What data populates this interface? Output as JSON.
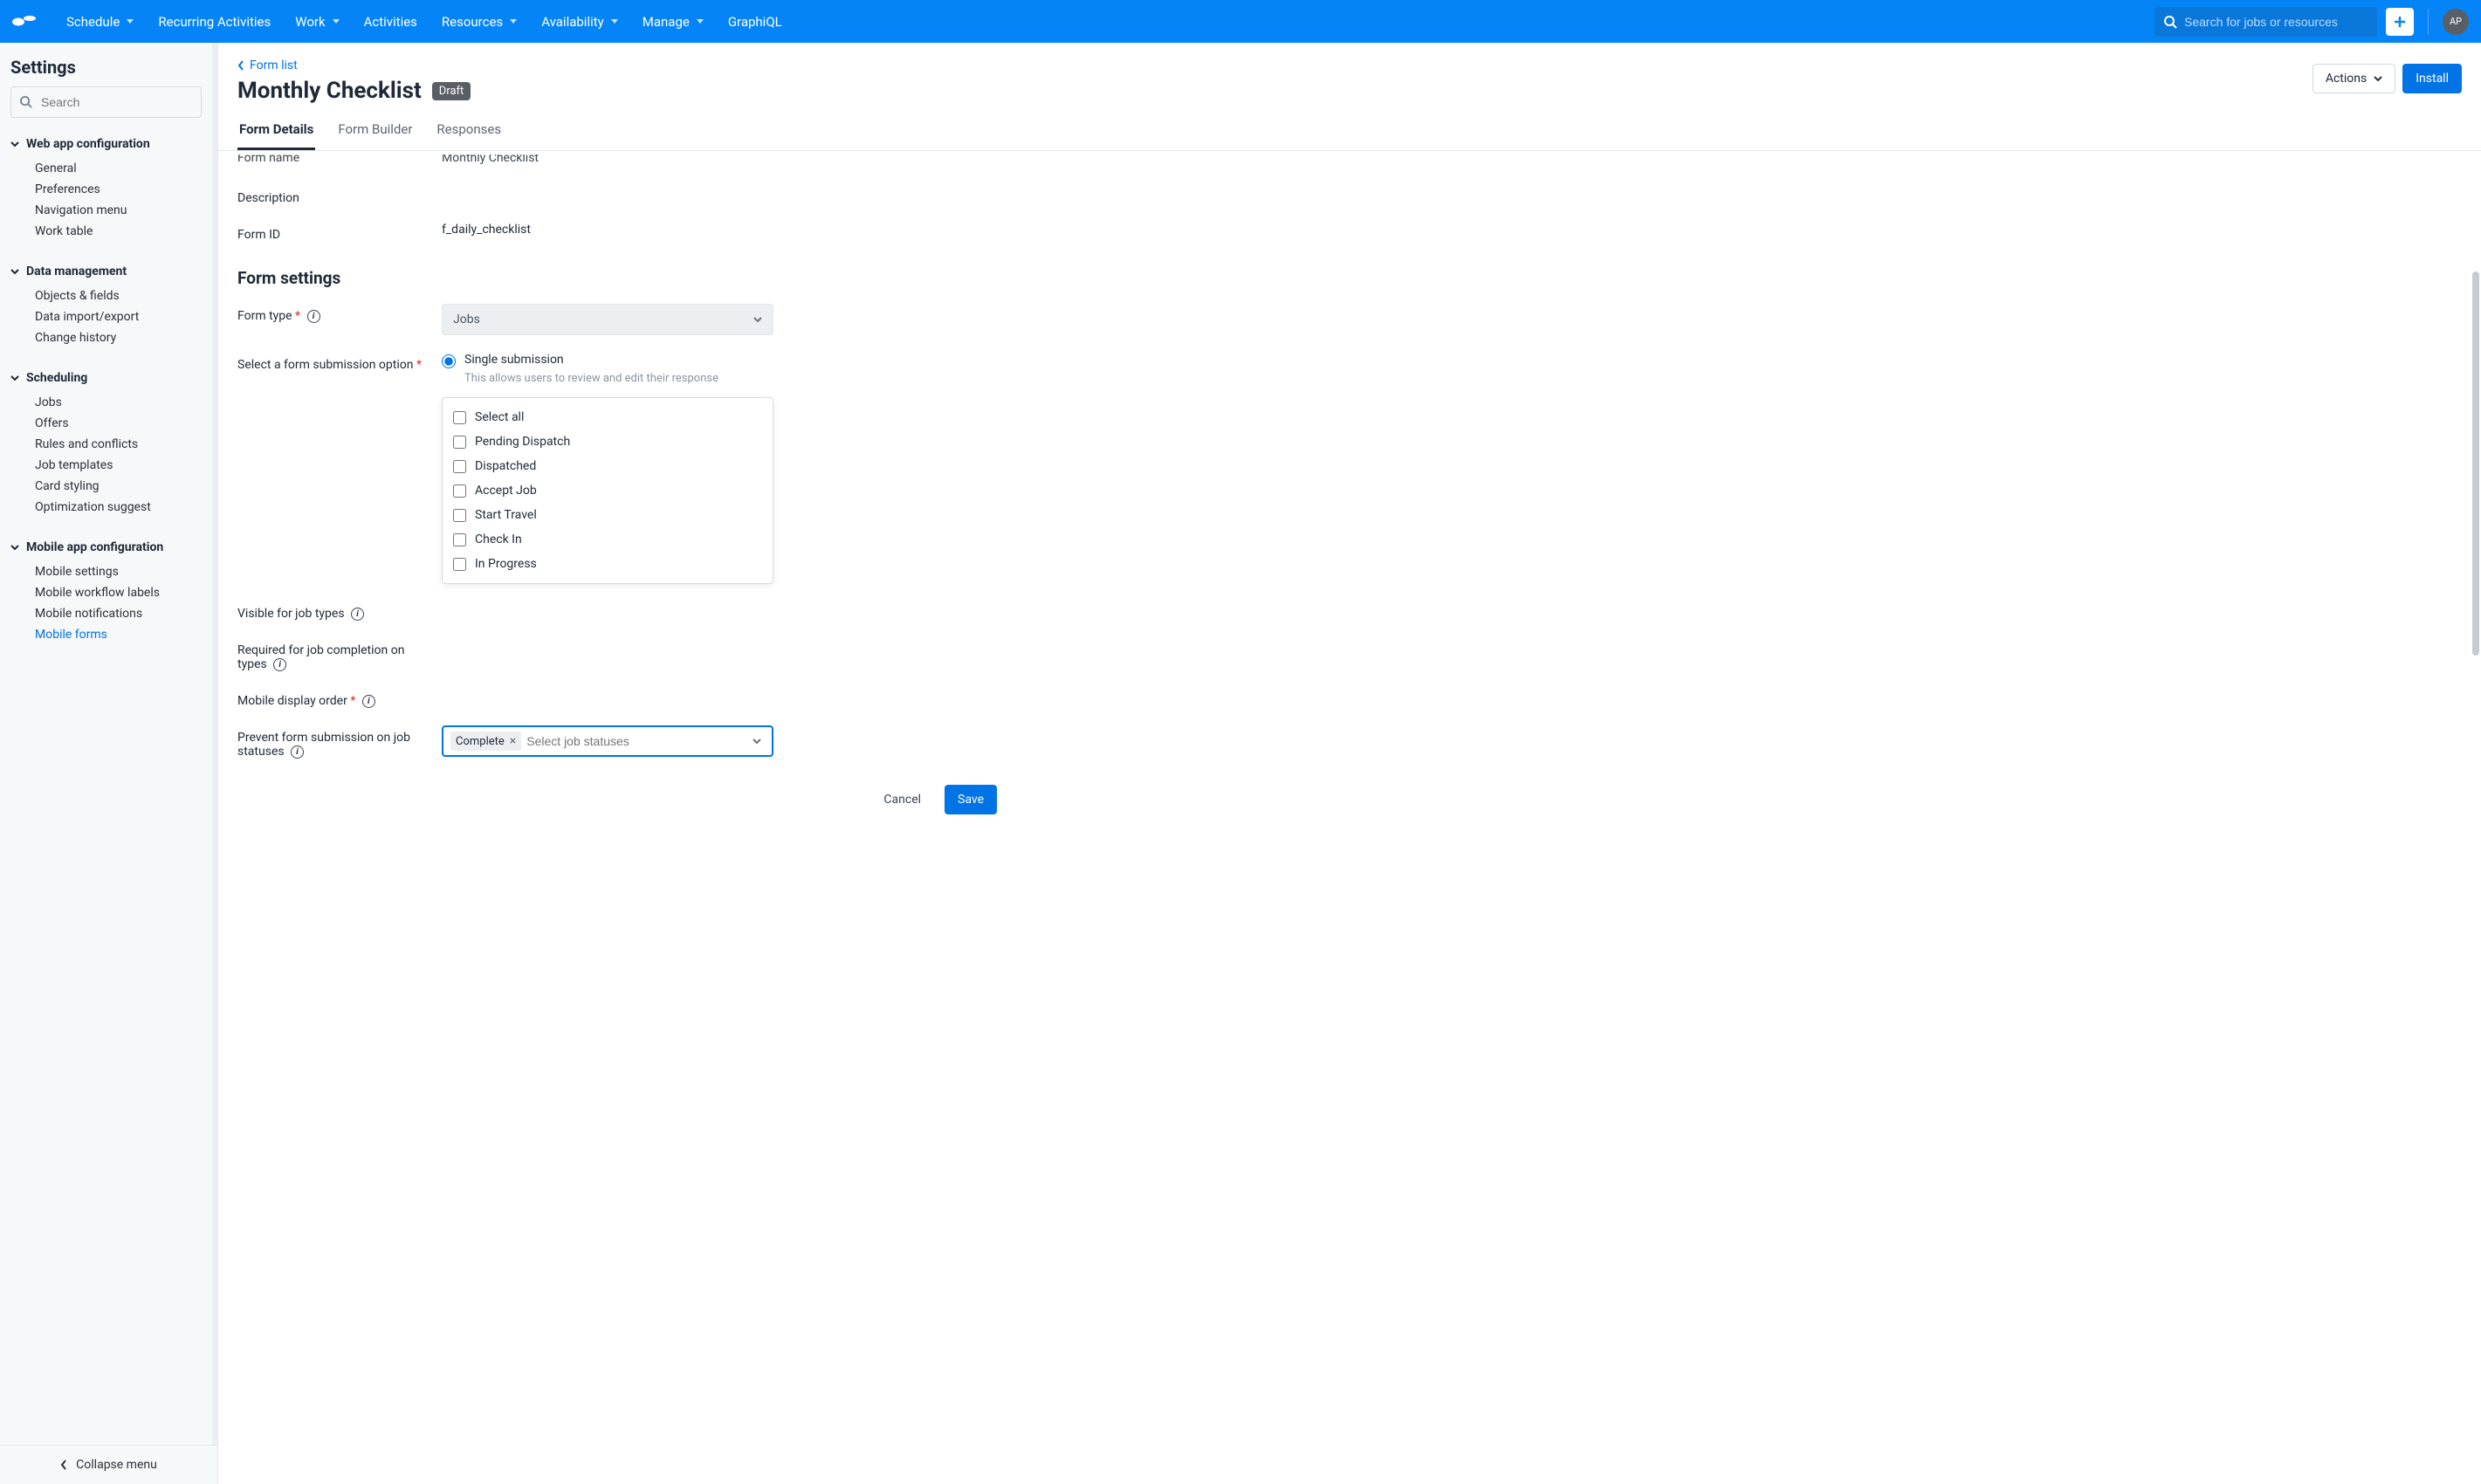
{
  "topnav": {
    "items": [
      "Schedule",
      "Recurring Activities",
      "Work",
      "Activities",
      "Resources",
      "Availability",
      "Manage",
      "GraphiQL"
    ],
    "dropdown_flags": [
      true,
      false,
      true,
      false,
      true,
      true,
      true,
      false
    ],
    "search_placeholder": "Search for jobs or resources",
    "avatar_initials": "AP"
  },
  "sidebar": {
    "title": "Settings",
    "search_placeholder": "Search",
    "groups": [
      {
        "label": "Web app configuration",
        "items": [
          "General",
          "Preferences",
          "Navigation menu",
          "Work table"
        ]
      },
      {
        "label": "Data management",
        "items": [
          "Objects & fields",
          "Data import/export",
          "Change history"
        ]
      },
      {
        "label": "Scheduling",
        "items": [
          "Jobs",
          "Offers",
          "Rules and conflicts",
          "Job templates",
          "Card styling",
          "Optimization suggest"
        ]
      },
      {
        "label": "Mobile app configuration",
        "items": [
          "Mobile settings",
          "Mobile workflow labels",
          "Mobile notifications",
          "Mobile forms"
        ],
        "active_index": 3
      }
    ],
    "collapse_label": "Collapse menu"
  },
  "header": {
    "back_link": "Form list",
    "title": "Monthly Checklist",
    "badge": "Draft",
    "actions_btn": "Actions",
    "install_btn": "Install"
  },
  "tabs": [
    "Form Details",
    "Form Builder",
    "Responses"
  ],
  "active_tab": 0,
  "form": {
    "name_label": "Form name",
    "name_value": "Monthly Checklist",
    "desc_label": "Description",
    "id_label": "Form ID",
    "id_value": "f_daily_checklist",
    "settings_title": "Form settings",
    "type_label": "Form type",
    "type_value": "Jobs",
    "submission_label": "Select a form submission option",
    "submission_option": "Single submission",
    "submission_help": "This allows users to review and edit their response",
    "visible_label": "Visible for job types",
    "required_label": "Required for job completion on types",
    "display_order_label": "Mobile display order",
    "prevent_label": "Prevent form submission on job statuses",
    "status_options": [
      "Select all",
      "Pending Dispatch",
      "Dispatched",
      "Accept Job",
      "Start Travel",
      "Check In",
      "In Progress"
    ],
    "selected_chip": "Complete",
    "multi_placeholder": "Select job statuses",
    "cancel": "Cancel",
    "save": "Save"
  }
}
